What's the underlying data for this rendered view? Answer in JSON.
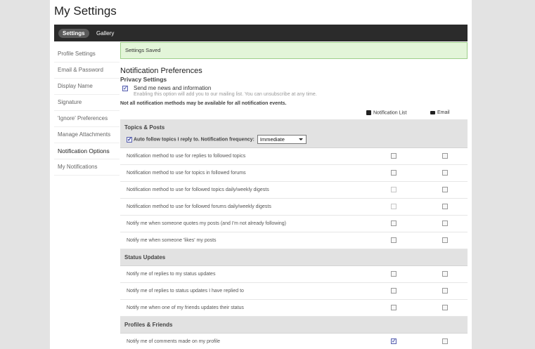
{
  "page": {
    "title": "My Settings"
  },
  "topbar": {
    "tabs": [
      {
        "label": "Settings",
        "active": true
      },
      {
        "label": "Gallery",
        "active": false
      }
    ]
  },
  "sidebar": {
    "items": [
      {
        "label": "Profile Settings",
        "active": false
      },
      {
        "label": "Email & Password",
        "active": false
      },
      {
        "label": "Display Name",
        "active": false
      },
      {
        "label": "Signature",
        "active": false
      },
      {
        "label": "'Ignore' Preferences",
        "active": false
      },
      {
        "label": "Manage Attachments",
        "active": false
      },
      {
        "label": "Notification Options",
        "active": true
      },
      {
        "label": "My Notifications",
        "active": false
      }
    ]
  },
  "main": {
    "saved_message": "Settings Saved",
    "heading": "Notification Preferences",
    "privacy": {
      "heading": "Privacy Settings",
      "checkbox_label": "Send me news and information",
      "checked": true,
      "description": "Enabling this option will add you to our mailing list. You can unsubscribe at any time."
    },
    "note": "Not all notification methods may be available for all notification events.",
    "columns": {
      "notification_list": "Notification List",
      "email": "Email",
      "notification_list_icon": "user-badge-icon",
      "email_icon": "envelope-icon"
    },
    "topics": {
      "title": "Topics & Posts",
      "auto_follow_label": "Auto follow topics I reply to. Notification frequency:",
      "auto_follow_checked": true,
      "frequency_value": "Immediate",
      "rows": [
        {
          "label": "Notification method to use for replies to followed topics",
          "list": false,
          "email": false,
          "list_enabled": true
        },
        {
          "label": "Notification method to use for topics in followed forums",
          "list": false,
          "email": false,
          "list_enabled": true
        },
        {
          "label": "Notification method to use for followed topics daily/weekly digests",
          "list": false,
          "email": false,
          "list_enabled": false
        },
        {
          "label": "Notification method to use for followed forums daily/weekly digests",
          "list": false,
          "email": false,
          "list_enabled": false
        },
        {
          "label": "Notify me when someone quotes my posts (and I'm not already following)",
          "list": false,
          "email": false,
          "list_enabled": true
        },
        {
          "label": "Notify me when someone 'likes' my posts",
          "list": false,
          "email": false,
          "list_enabled": true
        }
      ]
    },
    "status": {
      "title": "Status Updates",
      "rows": [
        {
          "label": "Notify me of replies to my status updates",
          "list": false,
          "email": false,
          "list_enabled": true
        },
        {
          "label": "Notify me of replies to status updates I have replied to",
          "list": false,
          "email": false,
          "list_enabled": true
        },
        {
          "label": "Notify me when one of my friends updates their status",
          "list": false,
          "email": false,
          "list_enabled": true
        }
      ]
    },
    "profiles": {
      "title": "Profiles & Friends",
      "rows": [
        {
          "label": "Notify me of comments made on my profile",
          "list": true,
          "email": false,
          "list_enabled": true
        }
      ]
    }
  }
}
